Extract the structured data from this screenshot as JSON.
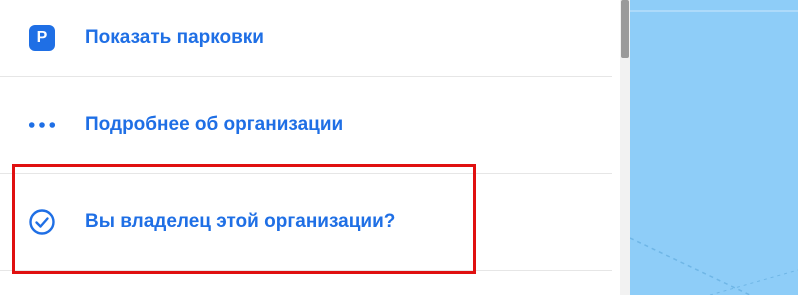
{
  "menu": {
    "items": [
      {
        "icon": "parking-icon",
        "icon_text": "P",
        "label": "Показать парковки"
      },
      {
        "icon": "more-dots-icon",
        "label": "Подробнее об организации"
      },
      {
        "icon": "check-circle-icon",
        "label": "Вы владелец этой организации?"
      }
    ]
  },
  "colors": {
    "link": "#1f6fe5",
    "highlight": "#e01010",
    "map_water": "#8ecdf8"
  }
}
